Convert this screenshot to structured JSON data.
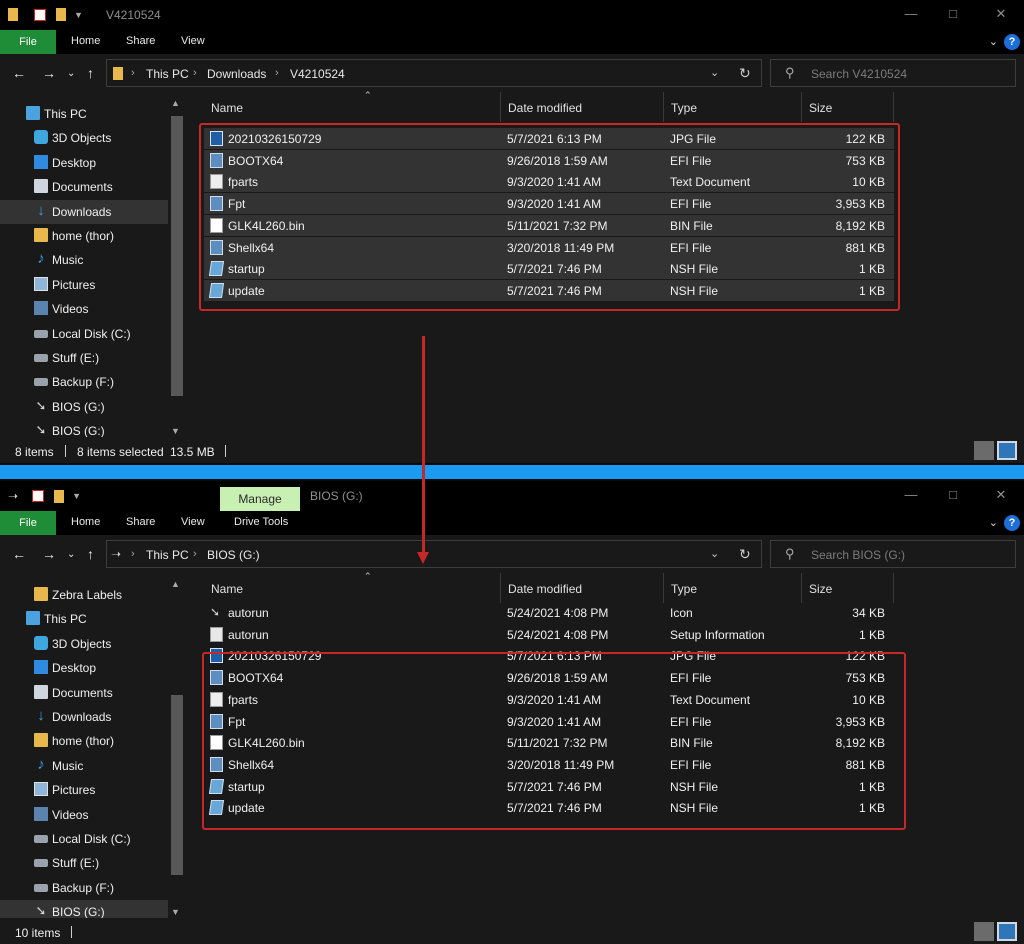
{
  "window1": {
    "title": "V4210524",
    "ribbon": {
      "file": "File",
      "tabs": [
        "Home",
        "Share",
        "View"
      ]
    },
    "breadcrumb": [
      "This PC",
      "Downloads",
      "V4210524"
    ],
    "search_placeholder": "Search V4210524",
    "nav": [
      {
        "label": "This PC",
        "icon": "pc-icon"
      },
      {
        "label": "3D Objects",
        "icon": "3d-objects-icon"
      },
      {
        "label": "Desktop",
        "icon": "desktop-icon"
      },
      {
        "label": "Documents",
        "icon": "documents-icon"
      },
      {
        "label": "Downloads",
        "icon": "downloads-icon",
        "selected": true
      },
      {
        "label": "home (thor)",
        "icon": "folder-icon"
      },
      {
        "label": "Music",
        "icon": "music-icon"
      },
      {
        "label": "Pictures",
        "icon": "pictures-icon"
      },
      {
        "label": "Videos",
        "icon": "videos-icon"
      },
      {
        "label": "Local Disk (C:)",
        "icon": "local-disk-icon"
      },
      {
        "label": "Stuff (E:)",
        "icon": "drive-icon"
      },
      {
        "label": "Backup (F:)",
        "icon": "drive-icon"
      },
      {
        "label": "BIOS (G:)",
        "icon": "usb-drive-icon"
      },
      {
        "label": "BIOS (G:)",
        "icon": "usb-drive-icon"
      }
    ],
    "columns": [
      "Name",
      "Date modified",
      "Type",
      "Size"
    ],
    "files": [
      {
        "name": "20210326150729",
        "date": "5/7/2021 6:13 PM",
        "type": "JPG File",
        "size": "122 KB",
        "icon": "jpg"
      },
      {
        "name": "BOOTX64",
        "date": "9/26/2018 1:59 AM",
        "type": "EFI File",
        "size": "753 KB",
        "icon": "efi"
      },
      {
        "name": "fparts",
        "date": "9/3/2020 1:41 AM",
        "type": "Text Document",
        "size": "10 KB",
        "icon": "txt"
      },
      {
        "name": "Fpt",
        "date": "9/3/2020 1:41 AM",
        "type": "EFI File",
        "size": "3,953 KB",
        "icon": "efi"
      },
      {
        "name": "GLK4L260.bin",
        "date": "5/11/2021 7:32 PM",
        "type": "BIN File",
        "size": "8,192 KB",
        "icon": "bin"
      },
      {
        "name": "Shellx64",
        "date": "3/20/2018 11:49 PM",
        "type": "EFI File",
        "size": "881 KB",
        "icon": "efi"
      },
      {
        "name": "startup",
        "date": "5/7/2021 7:46 PM",
        "type": "NSH File",
        "size": "1 KB",
        "icon": "nsh"
      },
      {
        "name": "update",
        "date": "5/7/2021 7:46 PM",
        "type": "NSH File",
        "size": "1 KB",
        "icon": "nsh"
      }
    ],
    "status": {
      "items": "8 items",
      "selected": "8 items selected",
      "size": "13.5 MB"
    }
  },
  "window2": {
    "title": "BIOS (G:)",
    "context_tab": "Manage",
    "ribbon": {
      "file": "File",
      "tabs": [
        "Home",
        "Share",
        "View",
        "Drive Tools"
      ]
    },
    "breadcrumb": [
      "This PC",
      "BIOS (G:)"
    ],
    "search_placeholder": "Search BIOS (G:)",
    "nav": [
      {
        "label": "Zebra Labels",
        "icon": "folder-icon"
      },
      {
        "label": "This PC",
        "icon": "pc-icon"
      },
      {
        "label": "3D Objects",
        "icon": "3d-objects-icon"
      },
      {
        "label": "Desktop",
        "icon": "desktop-icon"
      },
      {
        "label": "Documents",
        "icon": "documents-icon"
      },
      {
        "label": "Downloads",
        "icon": "downloads-icon"
      },
      {
        "label": "home (thor)",
        "icon": "folder-icon"
      },
      {
        "label": "Music",
        "icon": "music-icon"
      },
      {
        "label": "Pictures",
        "icon": "pictures-icon"
      },
      {
        "label": "Videos",
        "icon": "videos-icon"
      },
      {
        "label": "Local Disk (C:)",
        "icon": "local-disk-icon"
      },
      {
        "label": "Stuff (E:)",
        "icon": "drive-icon"
      },
      {
        "label": "Backup (F:)",
        "icon": "drive-icon"
      },
      {
        "label": "BIOS (G:)",
        "icon": "usb-drive-icon",
        "selected": true
      }
    ],
    "columns": [
      "Name",
      "Date modified",
      "Type",
      "Size"
    ],
    "files": [
      {
        "name": "autorun",
        "date": "5/24/2021 4:08 PM",
        "type": "Icon",
        "size": "34 KB",
        "icon": "ico"
      },
      {
        "name": "autorun",
        "date": "5/24/2021 4:08 PM",
        "type": "Setup Information",
        "size": "1 KB",
        "icon": "inf"
      },
      {
        "name": "20210326150729",
        "date": "5/7/2021 6:13 PM",
        "type": "JPG File",
        "size": "122 KB",
        "icon": "jpg"
      },
      {
        "name": "BOOTX64",
        "date": "9/26/2018 1:59 AM",
        "type": "EFI File",
        "size": "753 KB",
        "icon": "efi"
      },
      {
        "name": "fparts",
        "date": "9/3/2020 1:41 AM",
        "type": "Text Document",
        "size": "10 KB",
        "icon": "txt"
      },
      {
        "name": "Fpt",
        "date": "9/3/2020 1:41 AM",
        "type": "EFI File",
        "size": "3,953 KB",
        "icon": "efi"
      },
      {
        "name": "GLK4L260.bin",
        "date": "5/11/2021 7:32 PM",
        "type": "BIN File",
        "size": "8,192 KB",
        "icon": "bin"
      },
      {
        "name": "Shellx64",
        "date": "3/20/2018 11:49 PM",
        "type": "EFI File",
        "size": "881 KB",
        "icon": "efi"
      },
      {
        "name": "startup",
        "date": "5/7/2021 7:46 PM",
        "type": "NSH File",
        "size": "1 KB",
        "icon": "nsh"
      },
      {
        "name": "update",
        "date": "5/7/2021 7:46 PM",
        "type": "NSH File",
        "size": "1 KB",
        "icon": "nsh"
      }
    ],
    "status": {
      "items": "10 items"
    }
  },
  "colors": {
    "highlight": "#c62828",
    "file_tab": "#1f8d38",
    "manage_tab": "#c9f0b3",
    "separator": "#1b9af1"
  }
}
